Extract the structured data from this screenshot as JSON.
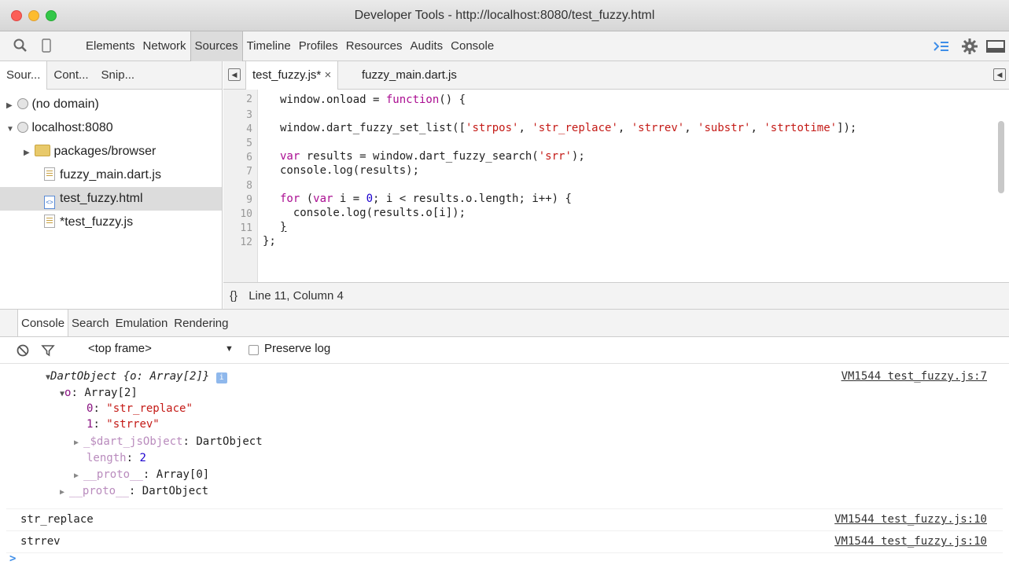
{
  "window": {
    "title": "Developer Tools - http://localhost:8080/test_fuzzy.html"
  },
  "toolbar": {
    "tabs": [
      "Elements",
      "Network",
      "Sources",
      "Timeline",
      "Profiles",
      "Resources",
      "Audits",
      "Console"
    ],
    "active_tab": "Sources"
  },
  "navigator": {
    "tabs": [
      "Sour...",
      "Cont...",
      "Snip..."
    ],
    "tree": [
      {
        "label": "(no domain)"
      },
      {
        "label": "localhost:8080"
      },
      {
        "label": "packages/browser"
      },
      {
        "label": "fuzzy_main.dart.js"
      },
      {
        "label": "test_fuzzy.html"
      },
      {
        "label": "*test_fuzzy.js"
      }
    ]
  },
  "editor": {
    "tabs": [
      {
        "label": "test_fuzzy.js*",
        "close": "×"
      },
      {
        "label": "fuzzy_main.dart.js"
      }
    ],
    "line_numbers": [
      "2",
      "3",
      "4",
      "5",
      "6",
      "7",
      "8",
      "9",
      "10",
      "11",
      "12"
    ],
    "lines": {
      "l2a": "window.onload = ",
      "l2b": "function",
      "l2c": "() {",
      "l4a": "window.dart_fuzzy_set_list([",
      "l4b": "'strpos'",
      "l4c": ", ",
      "l4d": "'str_replace'",
      "l4e": ", ",
      "l4f": "'strrev'",
      "l4g": ", ",
      "l4h": "'substr'",
      "l4i": ", ",
      "l4j": "'strtotime'",
      "l4k": "]);",
      "l6a": "var",
      "l6b": " results = window.dart_fuzzy_search(",
      "l6c": "'srr'",
      "l6d": ");",
      "l7": "console.log(results);",
      "l9a": "for",
      "l9b": " (",
      "l9c": "var",
      "l9d": " i = ",
      "l9e": "0",
      "l9f": "; i < results.o.length; i++) {",
      "l10": "  console.log(results.o[i]);",
      "l11": "}",
      "l12": "};"
    },
    "status": {
      "format_icon": "{}",
      "position": "Line 11, Column 4"
    }
  },
  "drawer": {
    "tabs": [
      "Console",
      "Search",
      "Emulation",
      "Rendering"
    ],
    "active_tab": "Console"
  },
  "console": {
    "frame_select": "<top frame>",
    "preserve_log_label": "Preserve log",
    "entries": {
      "obj_header": "DartObject {o: Array[2]}",
      "obj_info": "i",
      "o_key": "o",
      "o_val": ": Array[2]",
      "item0_key": "0",
      "item0_val": "\"str_replace\"",
      "item1_key": "1",
      "item1_val": "\"strrev\"",
      "jsobj_key": "_$dart_jsObject",
      "jsobj_val": ": DartObject",
      "length_key": "length",
      "length_val": "2",
      "proto1_key": "__proto__",
      "proto1_val": ": Array[0]",
      "proto2_key": "__proto__",
      "proto2_val": ": DartObject",
      "log1": "str_replace",
      "log2": "strrev",
      "src1": "VM1544 test_fuzzy.js:7",
      "src2": "VM1544 test_fuzzy.js:10",
      "src3": "VM1544 test_fuzzy.js:10",
      "prompt": ">"
    }
  }
}
